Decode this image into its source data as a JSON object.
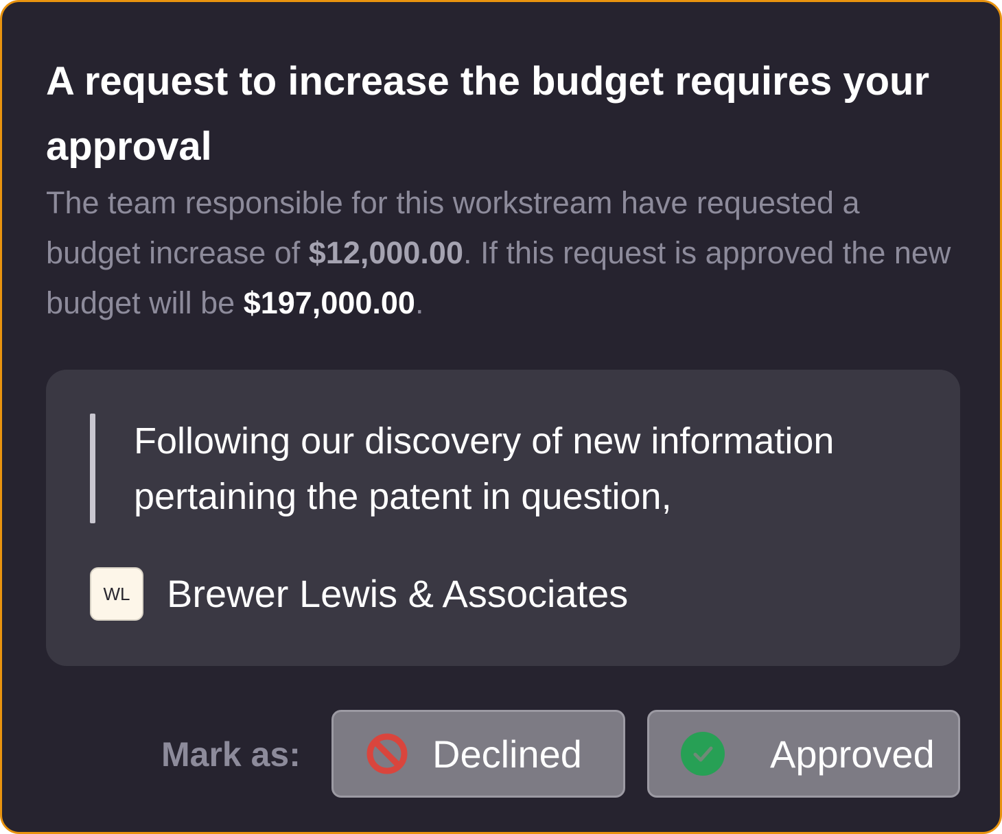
{
  "card": {
    "title": "A request to increase the budget requires your approval",
    "description": {
      "part1": "The team responsible for this workstream have requested a budget increase of ",
      "increase_amount": "$12,000.00",
      "part2": ".  If this request is approved the new budget will be ",
      "new_budget": "$197,000.00",
      "part3": "."
    }
  },
  "request": {
    "quote": "Following our discovery of new information pertaining the patent in question,",
    "requester_initials": "WL",
    "requester_name": "Brewer Lewis & Associates"
  },
  "actions": {
    "mark_as_label": "Mark as:",
    "declined_label": "Declined",
    "declined_icon": "prohibited-icon",
    "approved_label": "Approved",
    "approved_icon": "check-circle-icon"
  },
  "colors": {
    "card_background": "#26232f",
    "card_border": "#e8930f",
    "panel_background": "#3a3843",
    "decline_red": "#d9453d",
    "approve_green": "#27a055"
  }
}
